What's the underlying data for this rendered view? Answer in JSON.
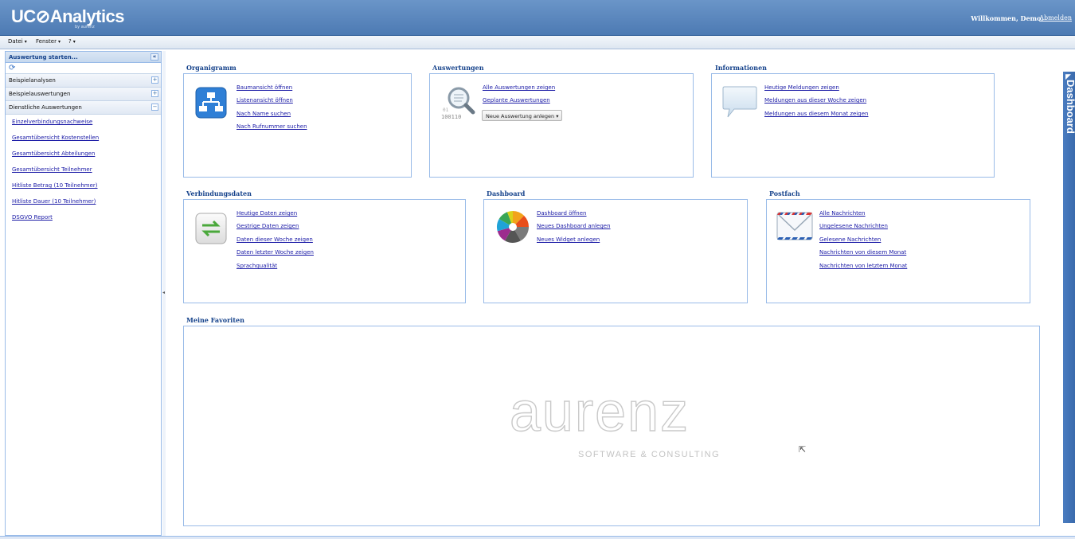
{
  "app": {
    "logo_text": "UC⊘Analytics",
    "logo_sub": "by aurenz",
    "welcome": "Willkommen, Demo.",
    "logout": "Abmelden"
  },
  "menubar": {
    "items": [
      {
        "label": "Datei"
      },
      {
        "label": "Fenster"
      },
      {
        "label": "?"
      }
    ]
  },
  "sidebar": {
    "title": "Auswertung starten...",
    "groups": [
      {
        "label": "Beispielanalysen",
        "toggle": "+"
      },
      {
        "label": "Beispielauswertungen",
        "toggle": "+"
      },
      {
        "label": "Dienstliche Auswertungen",
        "toggle": "−"
      }
    ],
    "links": [
      "Einzelverbindungsnachweise",
      "Gesamtübersicht Kostenstellen",
      "Gesamtübersicht Abteilungen",
      "Gesamtübersicht Teilnehmer",
      "Hitliste Betrag (10 Teilnehmer)",
      "Hitliste Dauer (10 Teilnehmer)",
      "DSGVO Report"
    ]
  },
  "sections": {
    "organigramm": {
      "title": "Organigramm",
      "links": [
        "Baumansicht öffnen",
        "Listenansicht öffnen",
        "Nach Name suchen",
        "Nach Rufnummer suchen"
      ]
    },
    "auswertungen": {
      "title": "Auswertungen",
      "links": [
        "Alle Auswertungen zeigen",
        "Geplante Auswertungen"
      ],
      "dropdown_label": "Neue Auswertung anlegen"
    },
    "informationen": {
      "title": "Informationen",
      "links": [
        "Heutige Meldungen zeigen",
        "Meldungen aus dieser Woche zeigen",
        "Meldungen aus diesem Monat zeigen"
      ]
    },
    "verbindungsdaten": {
      "title": "Verbindungsdaten",
      "links": [
        "Heutige Daten zeigen",
        "Gestrige Daten zeigen",
        "Daten dieser Woche zeigen",
        "Daten letzter Woche zeigen",
        "Sprachqualität"
      ]
    },
    "dashboard": {
      "title": "Dashboard",
      "links": [
        "Dashboard öffnen",
        "Neues Dashboard anlegen",
        "Neues Widget anlegen"
      ]
    },
    "postfach": {
      "title": "Postfach",
      "links": [
        "Alle Nachrichten",
        "Ungelesene Nachrichten",
        "Gelesene Nachrichten",
        "Nachrichten von diesem Monat",
        "Nachrichten von letztem Monat"
      ]
    },
    "favoriten": {
      "title": "Meine Favoriten",
      "watermark_word": "aurenz",
      "watermark_sub": "SOFTWARE & CONSULTING"
    }
  },
  "dashboard_tab": {
    "label": "Dashboard"
  },
  "colors": {
    "header": "#5584bd",
    "link": "#1a1aa6",
    "section_title": "#15428b",
    "panel_border": "#99bbe8"
  }
}
